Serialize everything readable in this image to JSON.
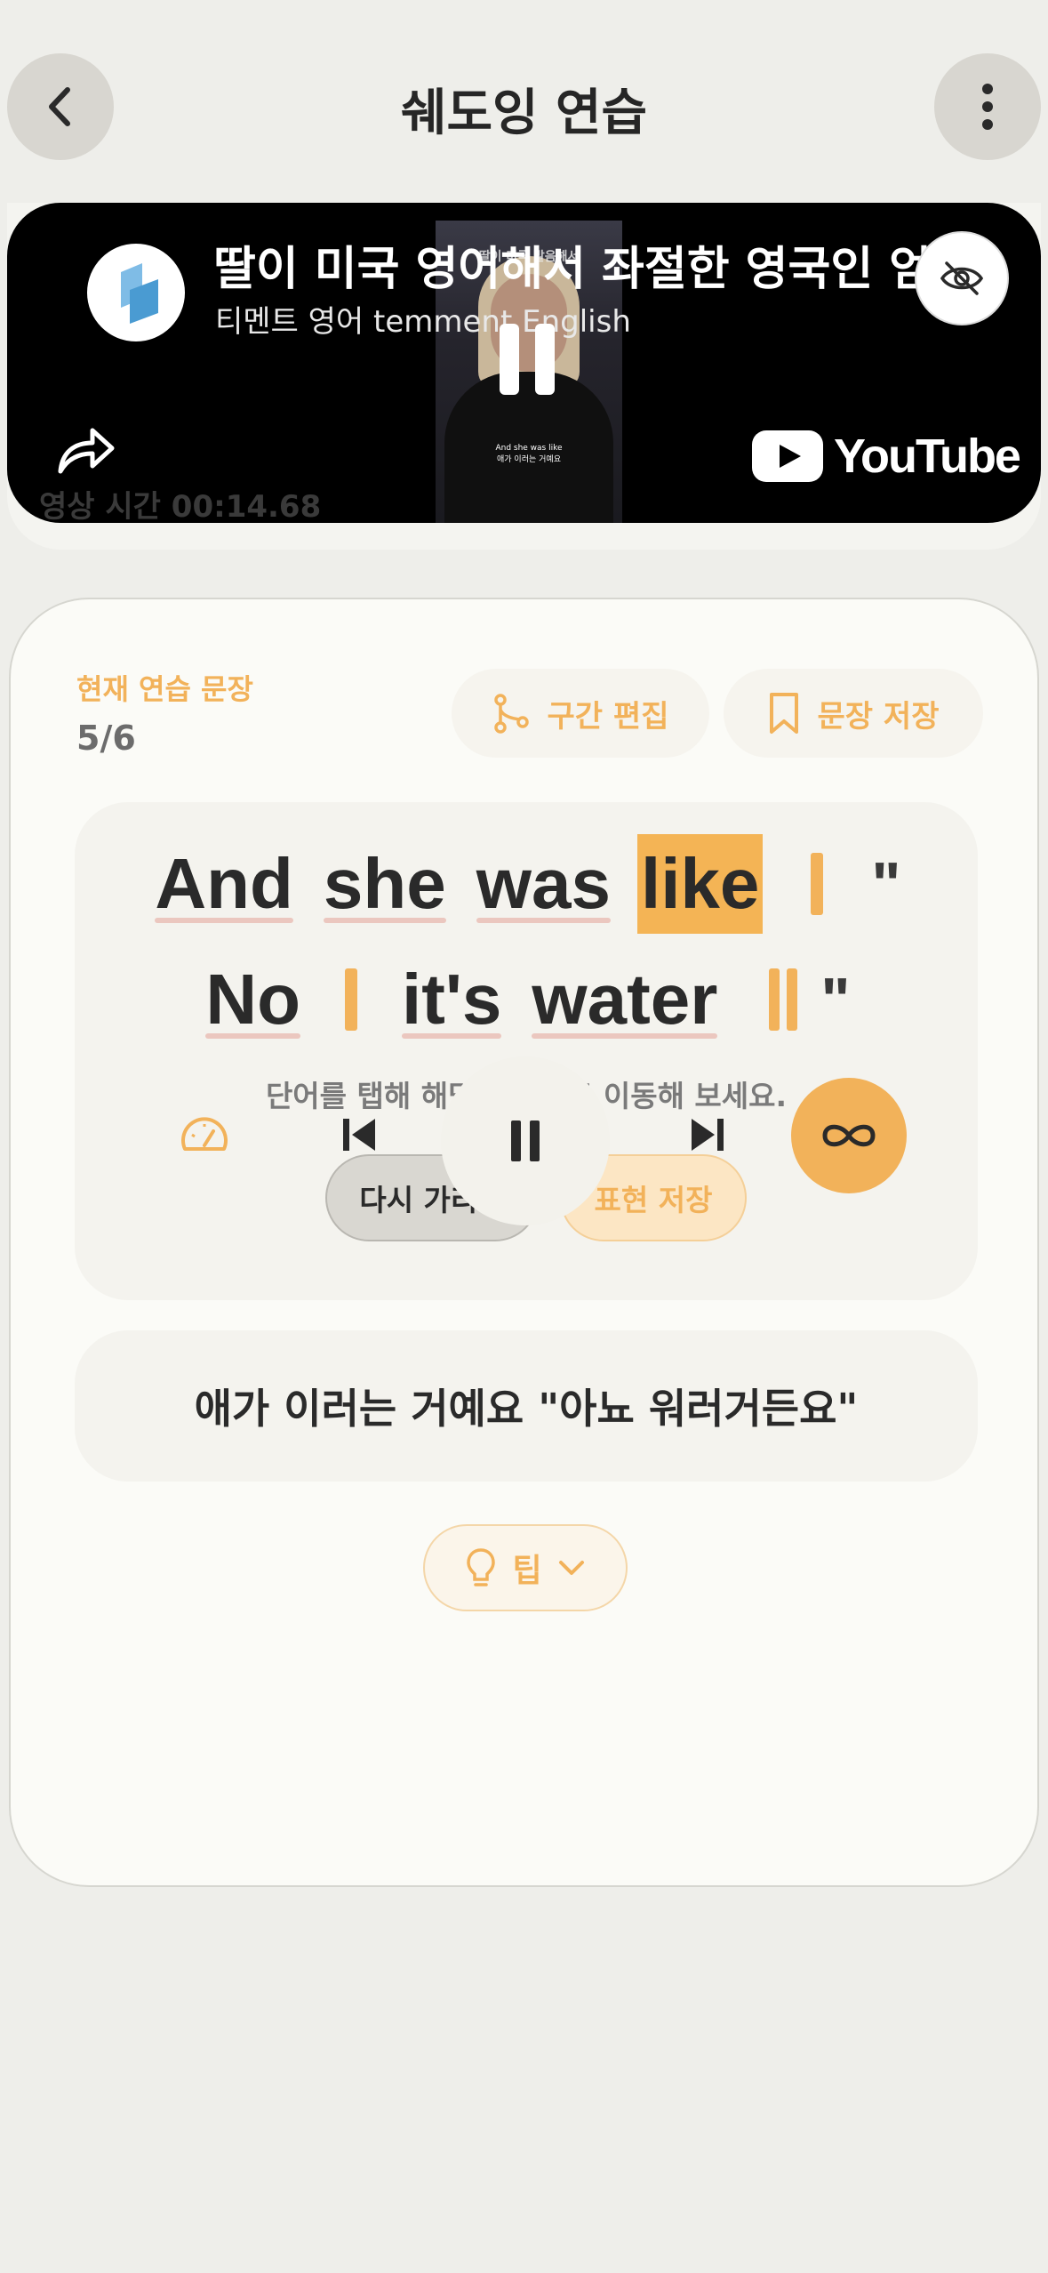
{
  "header": {
    "title": "쉐도잉 연습",
    "back_icon": "chevron-left-icon",
    "more_icon": "more-vertical-icon"
  },
  "video": {
    "title": "딸이 미국 영어해서 좌절한 영국인 엄마",
    "channel": "티멘트 영어 temment English",
    "thumb_top_caption": "딸이 미국 발음해서",
    "thumb_caption": "And she was like\n애가 이러는 거예요",
    "youtube_label": "YouTube",
    "time_text": "영상 시간 00:14.68"
  },
  "practice": {
    "current_label": "현재 연습 문장",
    "current_count": "5/6",
    "range_edit_label": "구간 편집",
    "save_sentence_label": "문장 저장",
    "line1": {
      "w1": "And",
      "w2": "she",
      "w3": "was",
      "w4": "like",
      "quote": "\""
    },
    "line2": {
      "w1": "No",
      "w2": "it's",
      "w3": "water",
      "quote": "\""
    },
    "tap_hint": "단어를 탭해 해당 구간으로 이동해 보세요.",
    "hide_again_label": "다시 가리기",
    "save_expression_label": "표현 저장",
    "translation": "애가 이러는 거예요 \"아뇨 워러거든요\"",
    "tip_label": "팁"
  },
  "colors": {
    "accent": "#f2b25a",
    "highlight": "#f4b455",
    "underline": "#ebc7bf",
    "background": "#eeeeea"
  }
}
